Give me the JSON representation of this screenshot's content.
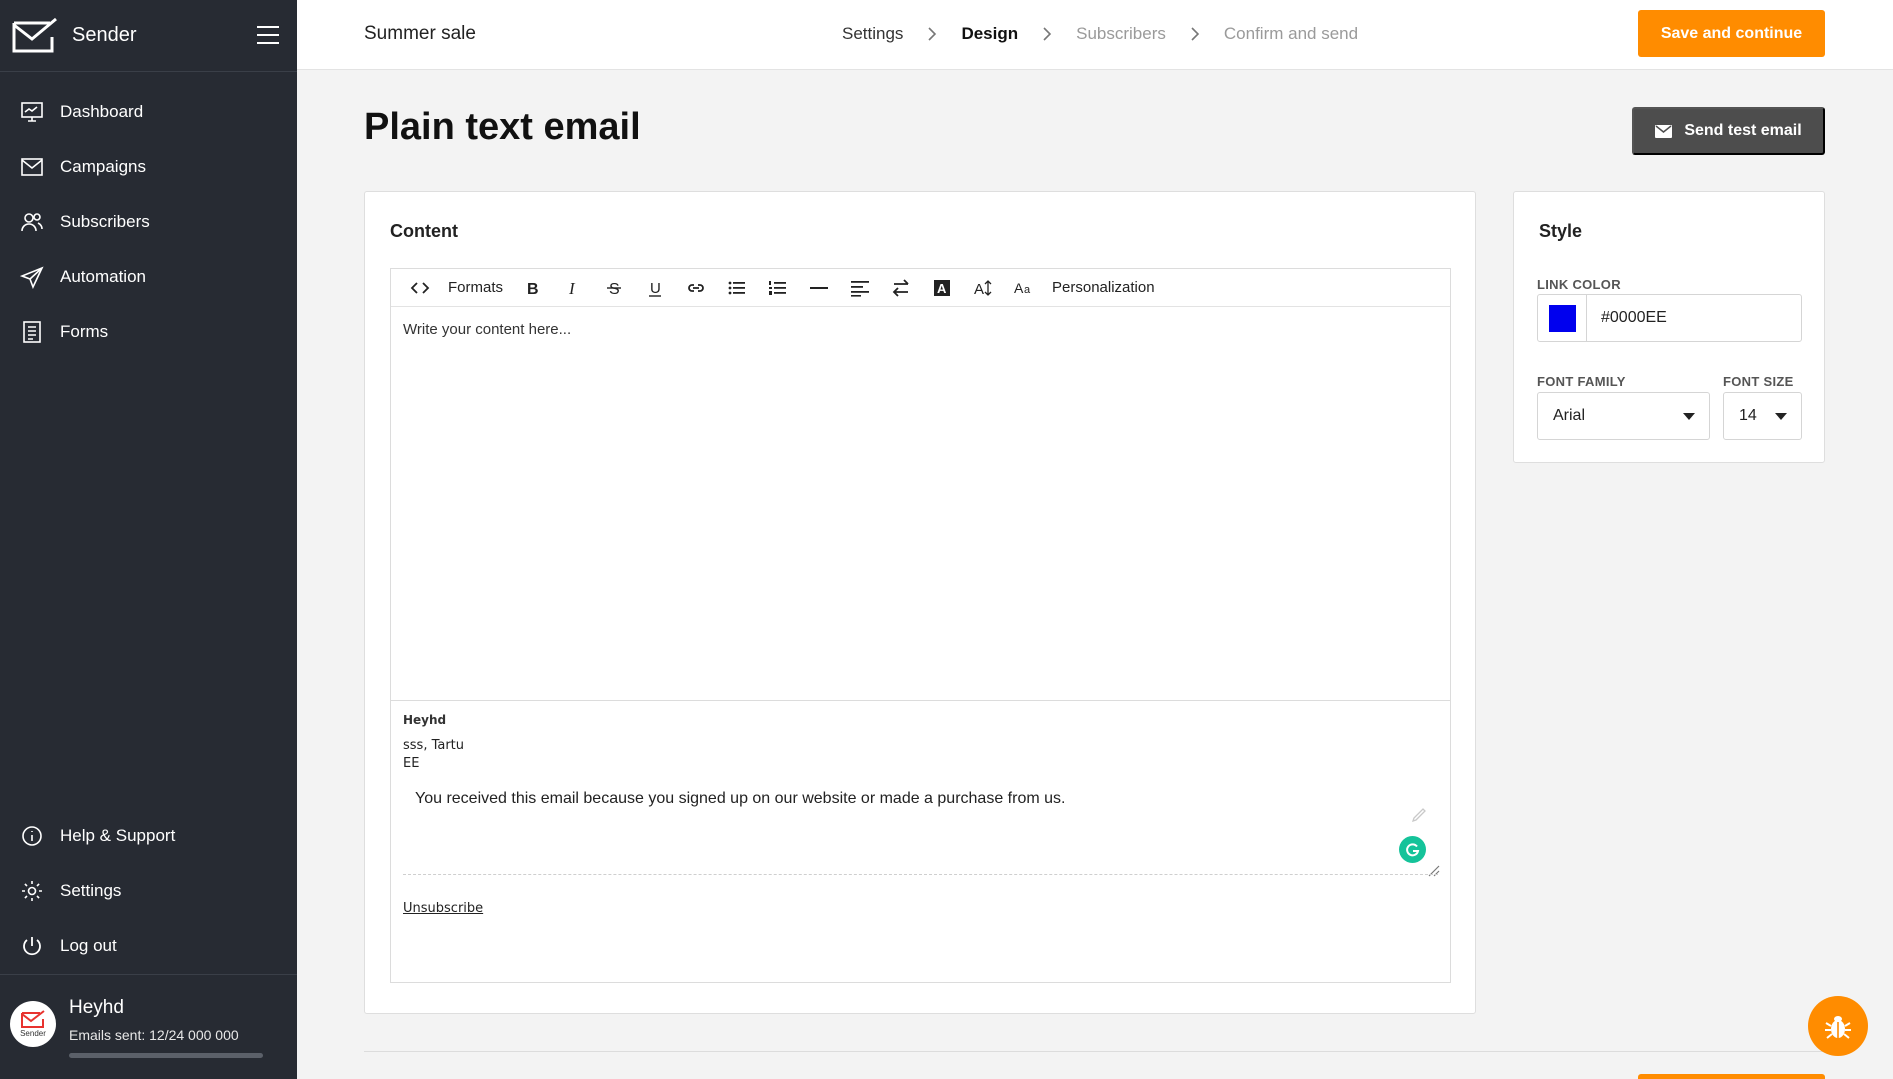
{
  "app": {
    "brand": "Sender"
  },
  "sidebar": {
    "items": [
      {
        "label": "Dashboard",
        "icon": "dashboard-icon"
      },
      {
        "label": "Campaigns",
        "icon": "envelope-icon"
      },
      {
        "label": "Subscribers",
        "icon": "users-icon"
      },
      {
        "label": "Automation",
        "icon": "paper-plane-icon"
      },
      {
        "label": "Forms",
        "icon": "form-icon"
      }
    ],
    "bottom_items": [
      {
        "label": "Help & Support",
        "icon": "info-icon"
      },
      {
        "label": "Settings",
        "icon": "gear-icon"
      },
      {
        "label": "Log out",
        "icon": "power-icon"
      }
    ],
    "user": {
      "name": "Heyhd",
      "emails_sent": "Emails sent: 12/24 000 000",
      "avatar_text": "Sender",
      "usage_fraction": 5e-07
    }
  },
  "topbar": {
    "campaign_title": "Summer sale",
    "steps": [
      "Settings",
      "Design",
      "Subscribers",
      "Confirm and send"
    ],
    "active_step": "Design",
    "save_label": "Save and continue"
  },
  "main": {
    "title": "Plain text email",
    "send_test_label": "Send test email"
  },
  "content": {
    "title": "Content",
    "toolbar": {
      "formats": "Formats",
      "personalization": "Personalization"
    },
    "placeholder": "Write your content here...",
    "footer": {
      "name": "Heyhd",
      "address_line1": "sss, Tartu",
      "address_line2": "EE",
      "note": "You received this email because you signed up on our website or made a purchase from us.",
      "unsubscribe": "Unsubscribe"
    }
  },
  "style": {
    "title": "Style",
    "link_color_label": "LINK COLOR",
    "link_color": "#0000EE",
    "font_family_label": "FONT FAMILY",
    "font_family": "Arial",
    "font_size_label": "FONT SIZE",
    "font_size": "14"
  },
  "colors": {
    "accent": "#ff8c00",
    "sidebar": "#272b33",
    "dark_button": "#4d4d4d",
    "grammarly": "#15c39a"
  }
}
